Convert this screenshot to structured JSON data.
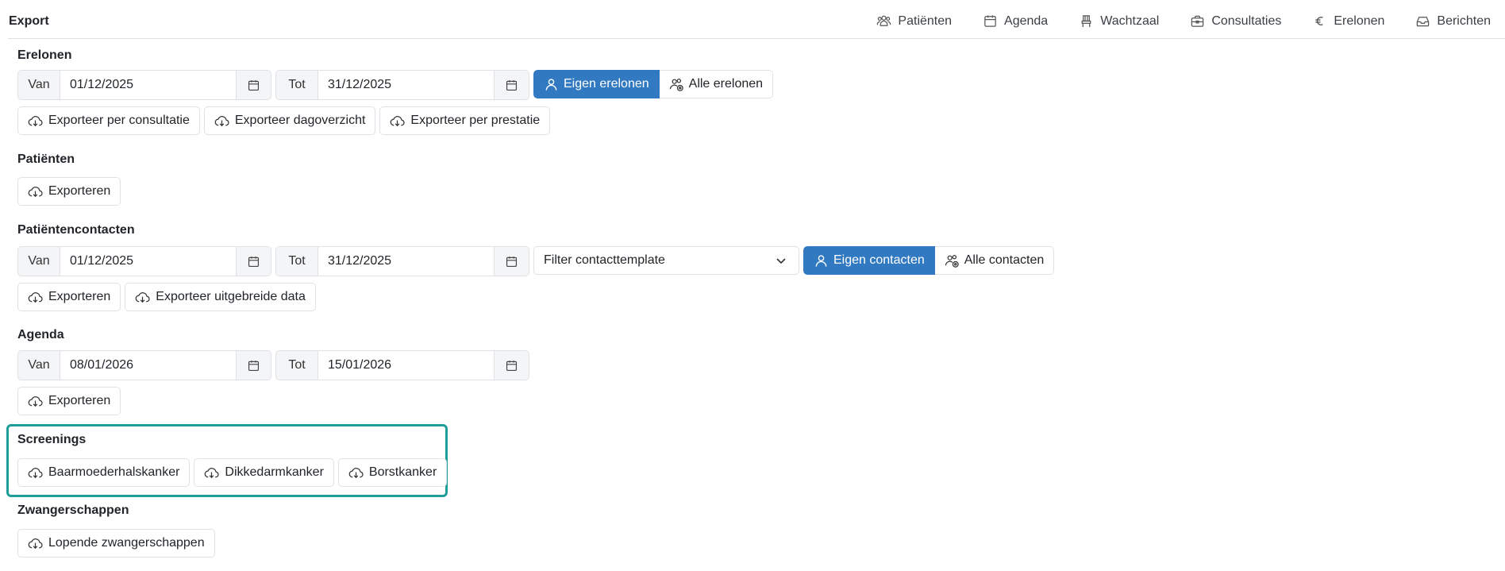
{
  "header": {
    "title": "Export",
    "nav": [
      {
        "label": "Patiënten",
        "icon": "patients-icon"
      },
      {
        "label": "Agenda",
        "icon": "calendar-icon"
      },
      {
        "label": "Wachtzaal",
        "icon": "chair-icon"
      },
      {
        "label": "Consultaties",
        "icon": "briefcase-icon"
      },
      {
        "label": "Erelonen",
        "icon": "euro-icon"
      },
      {
        "label": "Berichten",
        "icon": "inbox-icon"
      }
    ]
  },
  "erelonen": {
    "title": "Erelonen",
    "from_label": "Van",
    "from_value": "01/12/2025",
    "to_label": "Tot",
    "to_value": "31/12/2025",
    "own_label": "Eigen erelonen",
    "all_label": "Alle erelonen",
    "buttons": [
      "Exporteer per consultatie",
      "Exporteer dagoverzicht",
      "Exporteer per prestatie"
    ]
  },
  "patienten": {
    "title": "Patiënten",
    "export_label": "Exporteren"
  },
  "contacten": {
    "title": "Patiëntencontacten",
    "from_label": "Van",
    "from_value": "01/12/2025",
    "to_label": "Tot",
    "to_value": "31/12/2025",
    "filter_placeholder": "Filter contacttemplate",
    "own_label": "Eigen contacten",
    "all_label": "Alle contacten",
    "buttons": [
      "Exporteren",
      "Exporteer uitgebreide data"
    ]
  },
  "agenda": {
    "title": "Agenda",
    "from_label": "Van",
    "from_value": "08/01/2026",
    "to_label": "Tot",
    "to_value": "15/01/2026",
    "export_label": "Exporteren"
  },
  "screenings": {
    "title": "Screenings",
    "buttons": [
      "Baarmoederhalskanker",
      "Dikkedarmkanker",
      "Borstkanker"
    ],
    "highlight_color": "#1e9e9a"
  },
  "zwangerschappen": {
    "title": "Zwangerschappen",
    "button": "Lopende zwangerschappen"
  },
  "colors": {
    "primary": "#3179c0",
    "border": "#dee2e6",
    "addon_bg": "#f4f5f7"
  }
}
